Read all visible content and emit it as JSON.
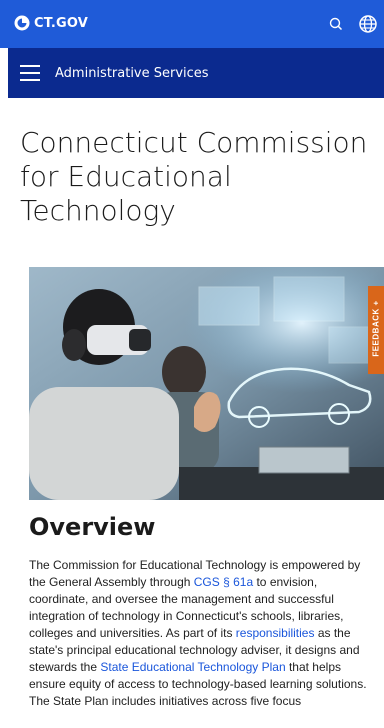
{
  "header": {
    "logo_text": "CT.GOV",
    "search_icon": "search-icon",
    "globe_icon": "globe-icon",
    "brand_color": "#1f5bd8"
  },
  "nav": {
    "label": "Administrative Services",
    "menu_icon": "hamburger-menu-icon",
    "bar_color": "#0b2a8f"
  },
  "page": {
    "title_line1": "Connecticut Commission",
    "title_line2": "for Educational",
    "title_line3": "Technology"
  },
  "feedback": {
    "label": "FEEDBACK +",
    "color": "#d9661a"
  },
  "overview": {
    "heading": "Overview",
    "p1": "The Commission for Educational Technology is empowered by the General Assembly through ",
    "link1": "CGS § 61a",
    "p2": " to envision, coordinate, and oversee the management and successful integration of technology in Connecticut's schools, libraries, colleges and universities. As part of its ",
    "link2": "responsibilities",
    "p3": " as the state's principal educational technology adviser, it designs and stewards the ",
    "link3": "State Educational Technology Plan",
    "p4": " that helps ensure equity of access to technology-based learning solutions. The State Plan includes initiatives across five focus",
    "link_color": "#1a56db"
  }
}
